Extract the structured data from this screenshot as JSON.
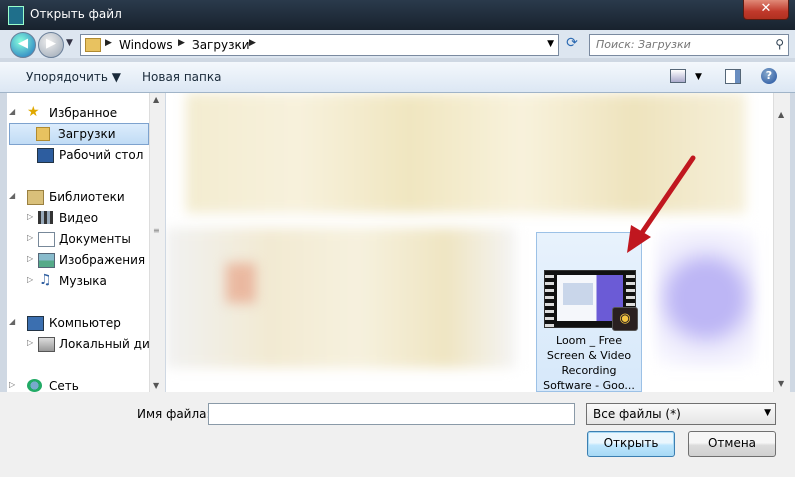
{
  "window": {
    "title": "Открыть файл",
    "close_label": "✕"
  },
  "nav": {
    "back_glyph": "◀",
    "forward_glyph": "▶",
    "breadcrumbs": [
      "Windows",
      "Загрузки"
    ],
    "search_placeholder": "Поиск: Загрузки"
  },
  "toolbar": {
    "organize_label": "Упорядочить ▼",
    "new_folder_label": "Новая папка",
    "help_label": "?"
  },
  "sidebar": {
    "items": [
      {
        "label": "Избранное",
        "icon": "star-icon"
      },
      {
        "label": "Загрузки",
        "icon": "downloads-folder-icon",
        "selected": true
      },
      {
        "label": "Рабочий стол",
        "icon": "desktop-icon"
      },
      {
        "label": "Библиотеки",
        "icon": "libraries-icon"
      },
      {
        "label": "Видео",
        "icon": "video-library-icon"
      },
      {
        "label": "Документы",
        "icon": "documents-library-icon"
      },
      {
        "label": "Изображения",
        "icon": "pictures-library-icon"
      },
      {
        "label": "Музыка",
        "icon": "music-library-icon"
      },
      {
        "label": "Компьютер",
        "icon": "computer-icon"
      },
      {
        "label": "Локальный диск",
        "icon": "disk-icon"
      },
      {
        "label": "Сеть",
        "icon": "network-icon"
      }
    ]
  },
  "content": {
    "selected_file": {
      "label": "Loom _ Free Screen & Video Recording Software - Goo..."
    },
    "colors": {
      "highlight_arrow": "#c0171f",
      "selection": "#d6e8fa"
    }
  },
  "footer": {
    "filename_label": "Имя файла:",
    "filename_value": "",
    "filter_value": "Все файлы (*)",
    "open_label": "Открыть",
    "cancel_label": "Отмена"
  }
}
